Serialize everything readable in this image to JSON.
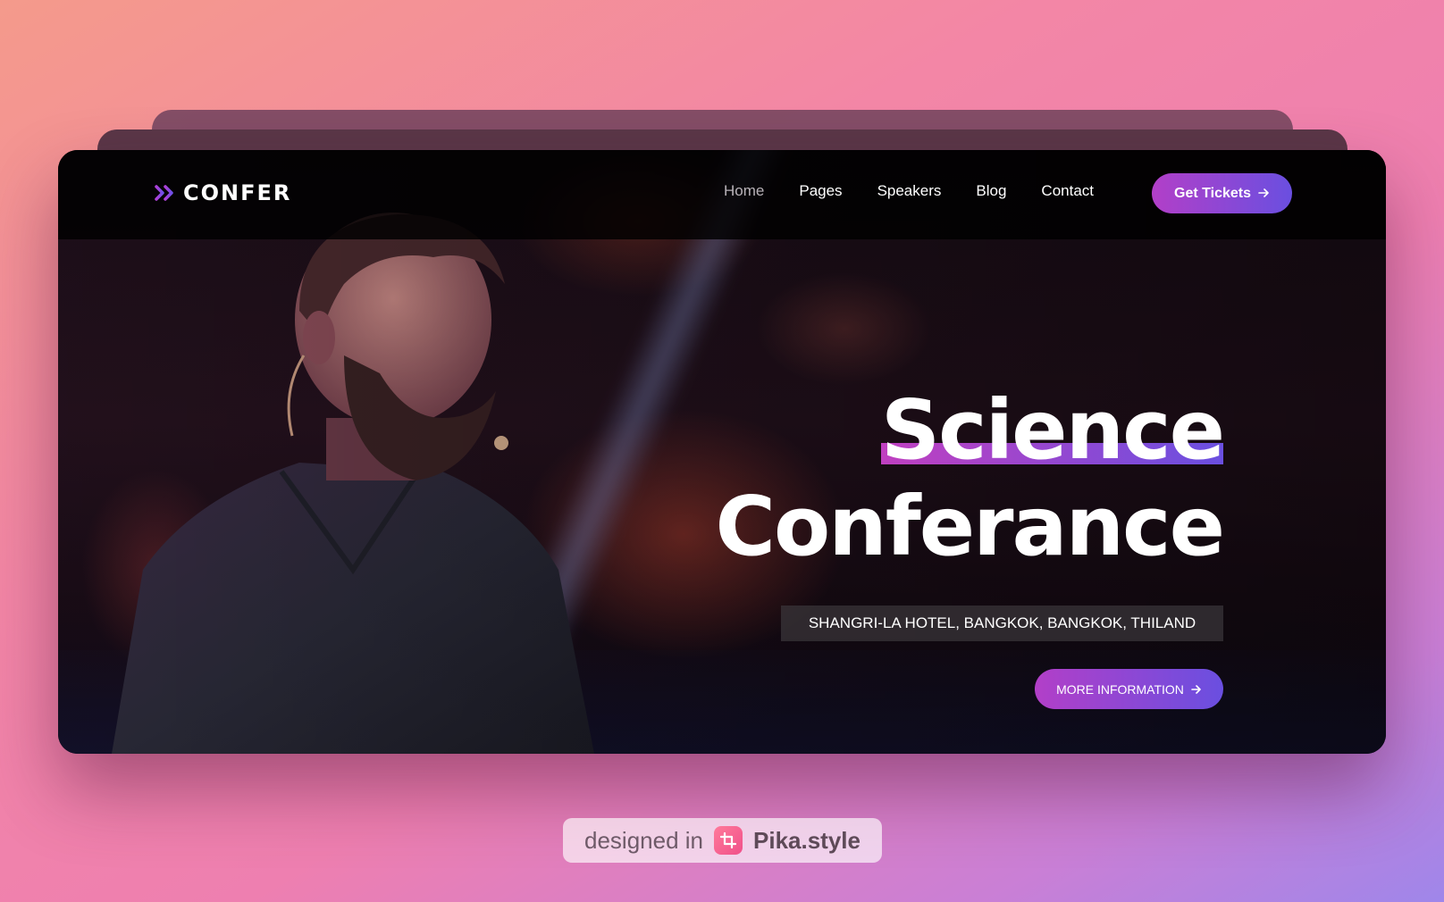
{
  "brand": {
    "name": "CONFER",
    "icon": "double-chevron-icon"
  },
  "nav": {
    "links": [
      {
        "label": "Home",
        "active": true
      },
      {
        "label": "Pages",
        "active": false
      },
      {
        "label": "Speakers",
        "active": false
      },
      {
        "label": "Blog",
        "active": false
      },
      {
        "label": "Contact",
        "active": false
      }
    ],
    "cta_label": "Get Tickets",
    "cta_icon": "arrow-right-icon"
  },
  "hero": {
    "title_line1": "Science",
    "title_line2": "Conferance",
    "location": "SHANGRI-LA HOTEL, BANGKOK, BANGKOK, THILAND",
    "more_label": "MORE INFORMATION",
    "more_icon": "arrow-right-icon"
  },
  "watermark": {
    "prefix": "designed in",
    "product": "Pika.style",
    "icon": "crop-icon"
  },
  "colors": {
    "accent_start": "#b23fc8",
    "accent_end": "#6a4fe0",
    "nav_bg": "#000000",
    "text": "#ffffff"
  }
}
